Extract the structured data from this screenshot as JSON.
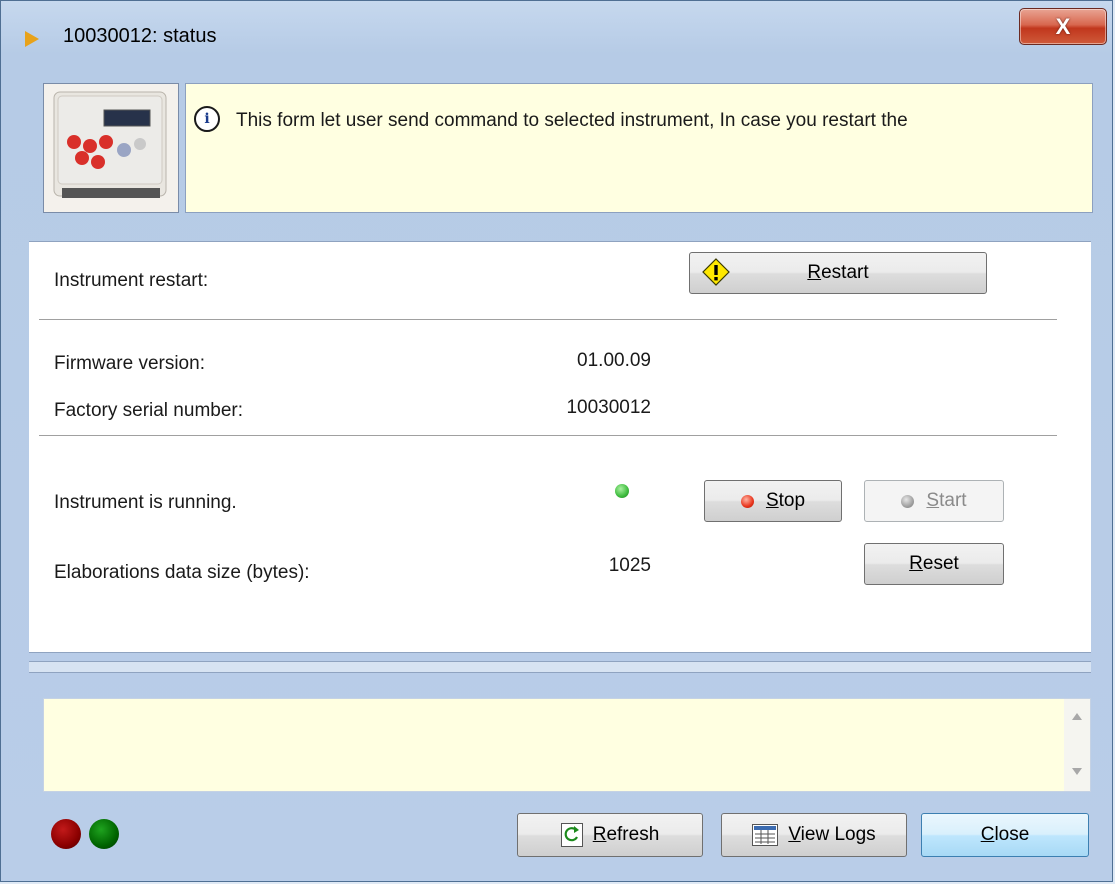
{
  "window": {
    "title": "10030012: status",
    "close_glyph": "X"
  },
  "header": {
    "info_text": "This form let user send command to selected instrument, In case you restart the",
    "info_glyph": "i"
  },
  "restart": {
    "label": "Instrument restart:",
    "button_prefix": "",
    "button_hotkey": "R",
    "button_rest": "estart"
  },
  "firmware": {
    "label": "Firmware version:",
    "value": "01.00.09"
  },
  "serial": {
    "label": "Factory serial number:",
    "value": "10030012"
  },
  "running": {
    "label": "Instrument is running.",
    "stop_hotkey": "S",
    "stop_rest": "top",
    "start_hotkey": "S",
    "start_rest": "tart"
  },
  "elaborations": {
    "label": "Elaborations data size (bytes):",
    "value": "1025",
    "reset_hotkey": "R",
    "reset_rest": "eset"
  },
  "footer": {
    "refresh_hotkey": "R",
    "refresh_rest": "efresh",
    "viewlogs_hotkey": "V",
    "viewlogs_rest": "iew Logs",
    "close_hotkey": "C",
    "close_rest": "lose"
  },
  "colors": {
    "led_red": "#8b0000",
    "led_green": "#006400",
    "status_green": "#3dbb3d",
    "stop_red": "#e8341c",
    "start_gray": "#a0a0a0",
    "info_bg": "#ffffe1"
  }
}
